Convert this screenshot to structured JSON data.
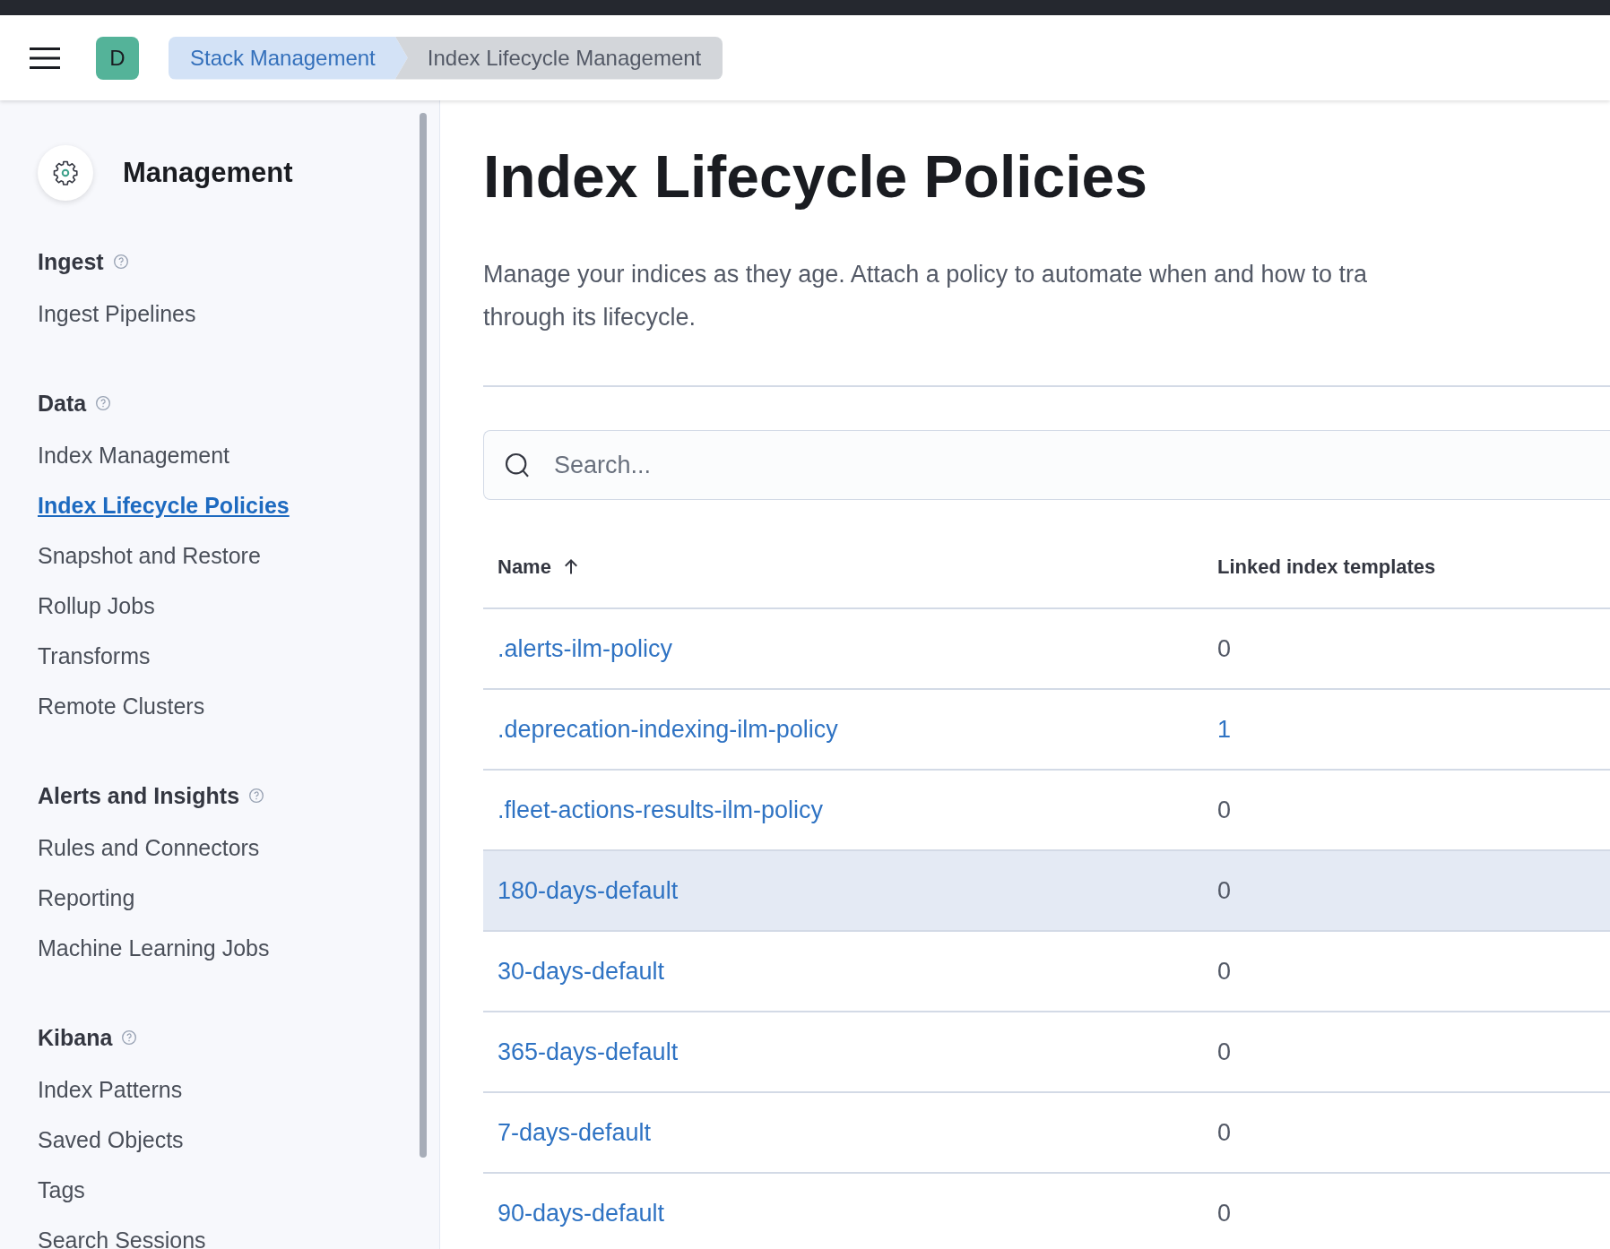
{
  "header": {
    "avatar": "D",
    "breadcrumbs": [
      {
        "label": "Stack Management",
        "selected": false
      },
      {
        "label": "Index Lifecycle Management",
        "selected": true
      }
    ]
  },
  "sidebar": {
    "title": "Management",
    "sections": [
      {
        "title": "Ingest",
        "items": [
          {
            "label": "Ingest Pipelines",
            "selected": false
          }
        ]
      },
      {
        "title": "Data",
        "items": [
          {
            "label": "Index Management",
            "selected": false
          },
          {
            "label": "Index Lifecycle Policies",
            "selected": true
          },
          {
            "label": "Snapshot and Restore",
            "selected": false
          },
          {
            "label": "Rollup Jobs",
            "selected": false
          },
          {
            "label": "Transforms",
            "selected": false
          },
          {
            "label": "Remote Clusters",
            "selected": false
          }
        ]
      },
      {
        "title": "Alerts and Insights",
        "items": [
          {
            "label": "Rules and Connectors",
            "selected": false
          },
          {
            "label": "Reporting",
            "selected": false
          },
          {
            "label": "Machine Learning Jobs",
            "selected": false
          }
        ]
      },
      {
        "title": "Kibana",
        "items": [
          {
            "label": "Index Patterns",
            "selected": false
          },
          {
            "label": "Saved Objects",
            "selected": false
          },
          {
            "label": "Tags",
            "selected": false
          },
          {
            "label": "Search Sessions",
            "selected": false
          }
        ]
      }
    ]
  },
  "page": {
    "title": "Index Lifecycle Policies",
    "description_lines": [
      "Manage your indices as they age. Attach a policy to automate when and how to tra",
      "through its lifecycle."
    ],
    "search": {
      "placeholder": "Search..."
    },
    "table": {
      "columns": [
        {
          "label": "Name",
          "sorted": true
        },
        {
          "label": "Linked index templates",
          "sorted": false
        }
      ],
      "rows": [
        {
          "name": ".alerts-ilm-policy",
          "linked": "0",
          "linked_is_link": false,
          "highlighted": false
        },
        {
          "name": ".deprecation-indexing-ilm-policy",
          "linked": "1",
          "linked_is_link": true,
          "highlighted": false
        },
        {
          "name": ".fleet-actions-results-ilm-policy",
          "linked": "0",
          "linked_is_link": false,
          "highlighted": false
        },
        {
          "name": "180-days-default",
          "linked": "0",
          "linked_is_link": false,
          "highlighted": true
        },
        {
          "name": "30-days-default",
          "linked": "0",
          "linked_is_link": false,
          "highlighted": false
        },
        {
          "name": "365-days-default",
          "linked": "0",
          "linked_is_link": false,
          "highlighted": false
        },
        {
          "name": "7-days-default",
          "linked": "0",
          "linked_is_link": false,
          "highlighted": false
        },
        {
          "name": "90-days-default",
          "linked": "0",
          "linked_is_link": false,
          "highlighted": false
        }
      ]
    }
  }
}
